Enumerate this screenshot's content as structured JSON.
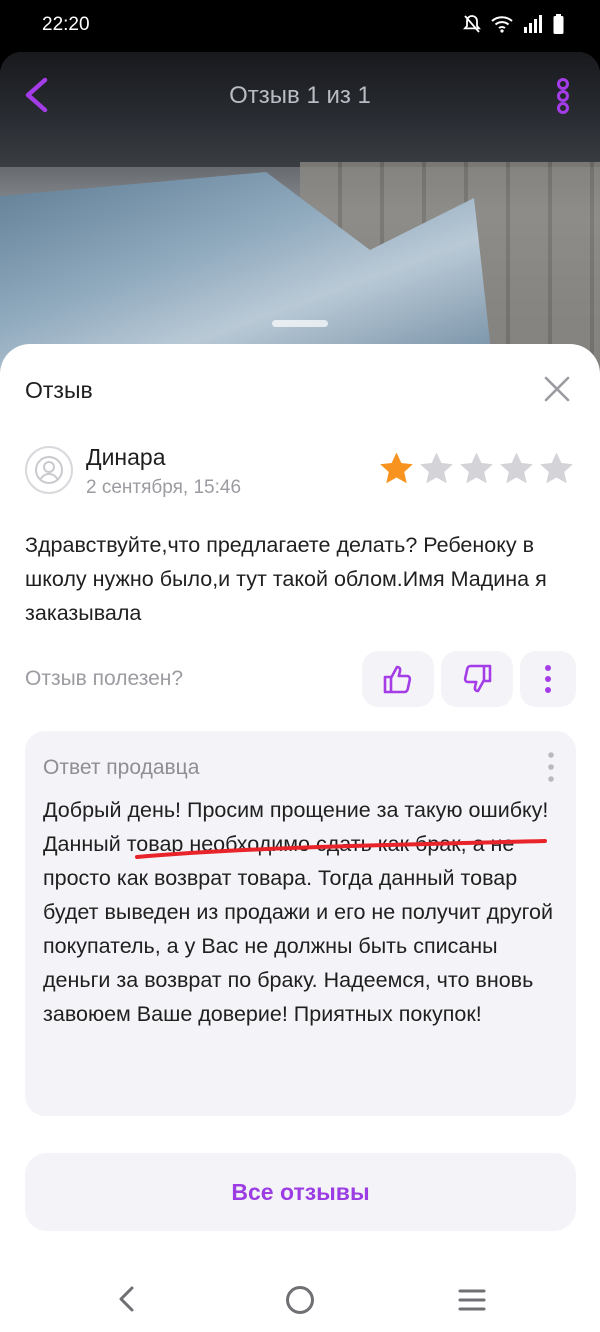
{
  "status_bar": {
    "time": "22:20"
  },
  "header": {
    "title": "Отзыв 1 из 1"
  },
  "sheet": {
    "title": "Отзыв"
  },
  "review": {
    "author": "Динара",
    "date": "2 сентября, 15:46",
    "rating": 1,
    "max_rating": 5,
    "text": "Здравствуйте,что предлагаете делать? Ребеноку в школу нужно было,и тут такой облом.Имя Мадина я заказывала"
  },
  "helpful": {
    "label": "Отзыв полезен?"
  },
  "seller_answer": {
    "title": "Ответ продавца",
    "text": "Добрый день! Просим прощение за такую ошибку! Данный товар необходимо сдать как брак, а не просто как возврат товара. Тогда данный товар будет выведен из продажи и его не получит другой покупатель, а у Вас не должны быть списаны деньги за возврат по браку. Надеемся, что вновь завоюем Ваше доверие! Приятных покупок!"
  },
  "buttons": {
    "all_reviews": "Все отзывы"
  },
  "colors": {
    "accent": "#9b3de3",
    "star_filled": "#f7931e",
    "star_empty": "#d3d3d8",
    "annotation": "#e8232a"
  }
}
